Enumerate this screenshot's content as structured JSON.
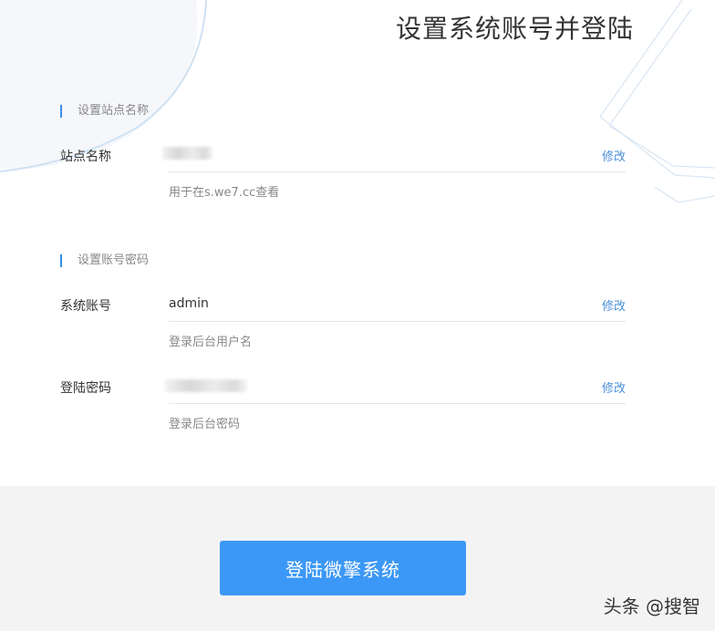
{
  "page": {
    "title": "设置系统账号并登陆"
  },
  "site_section": {
    "heading": "设置站点名称",
    "site_name": {
      "label": "站点名称",
      "value": "",
      "edit_label": "修改",
      "hint": "用于在s.we7.cc查看"
    }
  },
  "account_section": {
    "heading": "设置账号密码",
    "account": {
      "label": "系统账号",
      "value": "admin",
      "edit_label": "修改",
      "hint": "登录后台用户名"
    },
    "password": {
      "label": "登陆密码",
      "value": "",
      "edit_label": "修改",
      "hint": "登录后台密码"
    }
  },
  "footer": {
    "submit_label": "登陆微擎系统"
  },
  "watermark": "头条 @搜智",
  "colors": {
    "accent": "#3c98f6",
    "link": "#4a90d9",
    "section_bar": "#3a8ee6",
    "footer_bg": "#f3f3f3"
  }
}
